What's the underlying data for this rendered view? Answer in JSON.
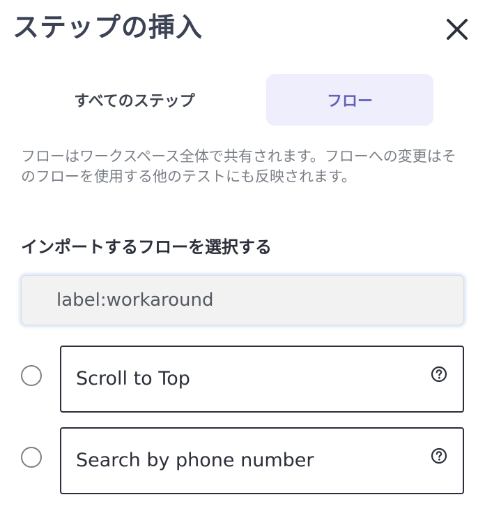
{
  "dialog": {
    "title": "ステップの挿入",
    "close_icon": "close-icon"
  },
  "tabs": [
    {
      "label": "すべてのステップ",
      "active": false
    },
    {
      "label": "フロー",
      "active": true
    }
  ],
  "description": "フローはワークスペース全体で共有されます。フローへの変更はそのフローを使用する他のテストにも反映されます。",
  "section_title": "インポートするフローを選択する",
  "search": {
    "value": "label:workaround",
    "placeholder": ""
  },
  "flows": [
    {
      "name": "Scroll to Top",
      "selected": false,
      "icon": "help-icon"
    },
    {
      "name": "Search by phone number",
      "selected": false,
      "icon": "help-icon"
    }
  ],
  "colors": {
    "active_tab_bg": "#eeeefc",
    "active_tab_text": "#6560b8",
    "title": "#3a4254"
  }
}
